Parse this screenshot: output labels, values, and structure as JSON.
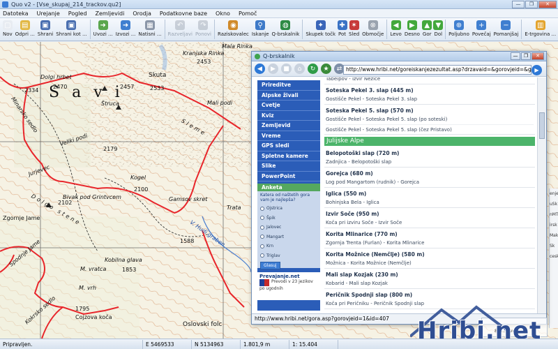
{
  "window": {
    "title": "Quo v2 - [Vse_skupaj_214_trackov.qu2]",
    "controls": [
      "—",
      "❐",
      "✕"
    ]
  },
  "menu": [
    "Datoteka",
    "Urejanje",
    "Pogled",
    "Zemljevidi",
    "Orodja",
    "Podatkovne baze",
    "Okno",
    "Pomoč"
  ],
  "toolbar": [
    {
      "label": "Nov",
      "icon": "new-document-icon",
      "color": "#e8ecf2",
      "glyph": "▢",
      "disabled": false
    },
    {
      "label": "Odpri ...",
      "icon": "open-folder-icon",
      "color": "#e2b844",
      "glyph": "▤",
      "disabled": false
    },
    {
      "label": "Shrani",
      "icon": "save-icon",
      "color": "#4a6fb0",
      "glyph": "▣",
      "disabled": false
    },
    {
      "label": "Shrani kot ...",
      "icon": "save-as-icon",
      "color": "#4a6fb0",
      "glyph": "▣",
      "disabled": false
    },
    {
      "label": "Uvozi ...",
      "icon": "import-icon",
      "color": "#5aa64d",
      "glyph": "➜",
      "disabled": false
    },
    {
      "label": "Izvozi ...",
      "icon": "export-icon",
      "color": "#3f7fd0",
      "glyph": "➜",
      "disabled": false
    },
    {
      "label": "Natisni ...",
      "icon": "print-icon",
      "color": "#8a96a8",
      "glyph": "▦",
      "disabled": false
    },
    {
      "label": "Razveljavi",
      "icon": "undo-icon",
      "color": "#9aa3af",
      "glyph": "↶",
      "disabled": true
    },
    {
      "label": "Ponovi",
      "icon": "redo-icon",
      "color": "#9aa3af",
      "glyph": "↷",
      "disabled": true
    },
    {
      "label": "Raziskovalec",
      "icon": "explorer-icon",
      "color": "#d08a2a",
      "glyph": "◉",
      "disabled": false
    },
    {
      "label": "Iskanje",
      "icon": "search-icon",
      "color": "#3e7ac8",
      "glyph": "⚲",
      "disabled": false
    },
    {
      "label": "Q-brskalnik",
      "icon": "q-browser-icon",
      "color": "#2d8a44",
      "glyph": "◍",
      "disabled": false
    },
    {
      "label": "Skupek točk",
      "icon": "waypoints-icon",
      "color": "#3a65b8",
      "glyph": "✦",
      "disabled": false
    },
    {
      "label": "Pot",
      "icon": "route-icon",
      "color": "#3a72c4",
      "glyph": "✚",
      "disabled": false
    },
    {
      "label": "Sled",
      "icon": "track-icon",
      "color": "#c73a3a",
      "glyph": "✶",
      "disabled": false
    },
    {
      "label": "Območje",
      "icon": "area-icon",
      "color": "#9aa3af",
      "glyph": "⊗",
      "disabled": false
    },
    {
      "label": "Levo",
      "icon": "arrow-left-icon",
      "color": "#43a83c",
      "glyph": "◀",
      "disabled": false
    },
    {
      "label": "Desno",
      "icon": "arrow-right-icon",
      "color": "#43a83c",
      "glyph": "▶",
      "disabled": false
    },
    {
      "label": "Gor",
      "icon": "arrow-up-icon",
      "color": "#43a83c",
      "glyph": "▲",
      "disabled": false
    },
    {
      "label": "Dol",
      "icon": "arrow-down-icon",
      "color": "#43a83c",
      "glyph": "▼",
      "disabled": false
    },
    {
      "label": "Poljubno",
      "icon": "zoom-custom-icon",
      "color": "#3f7fd0",
      "glyph": "⊕",
      "disabled": false
    },
    {
      "label": "Povečaj",
      "icon": "zoom-in-icon",
      "color": "#3f7fd0",
      "glyph": "+",
      "disabled": false
    },
    {
      "label": "Pomanjšaj",
      "icon": "zoom-out-icon",
      "color": "#3f7fd0",
      "glyph": "−",
      "disabled": false
    },
    {
      "label": "E-trgovina ...",
      "icon": "eshop-icon",
      "color": "#e3a42e",
      "glyph": "▥",
      "disabled": false
    }
  ],
  "map": {
    "region_label": "Savi",
    "peaks": [
      {
        "name": "Skuta",
        "elev": "2533"
      },
      {
        "name": "Kranjska Rinka",
        "elev": "2453"
      },
      {
        "name": "Mala Rinka",
        "elev": ""
      },
      {
        "name": "Dolgi hrbet",
        "elev": "2470"
      },
      {
        "name": "Štruca",
        "elev": "2457"
      },
      {
        "name": "Mali podi",
        "elev": ""
      },
      {
        "name": "Veliki podi",
        "elev": "2179"
      },
      {
        "name": "Kogel",
        "elev": "2100"
      },
      {
        "name": "Gamsov skret",
        "elev": ""
      },
      {
        "name": "Bivak pod Grintvcem",
        "elev": "2102"
      },
      {
        "name": "Kobilna glava",
        "elev": "1853"
      },
      {
        "name": "M. vratca",
        "elev": ""
      },
      {
        "name": "M. vrh",
        "elev": "1795"
      },
      {
        "name": "Cojzova koča",
        "elev": ""
      },
      {
        "name": "Oslovski folc",
        "elev": ""
      },
      {
        "name": "Trata",
        "elev": ""
      },
      {
        "name": "Zgornje Jame",
        "elev": ""
      },
      {
        "name": "Spodnje Jame",
        "elev": ""
      },
      {
        "name": "Kokrsko sedlo",
        "elev": ""
      },
      {
        "name": "Jurjevec",
        "elev": ""
      },
      {
        "name": "Dolgo stene",
        "elev": ""
      },
      {
        "name": "Minarsko sedlo",
        "elev": ""
      },
      {
        "name": "V. Hudi graben",
        "elev": "1588"
      },
      {
        "name": "Sleme",
        "elev": ""
      },
      {
        "name": "2334",
        "elev": ""
      }
    ]
  },
  "browser": {
    "title": "Q-brskalnik",
    "url": "http://www.hribi.net/goreiskanjezezultat.asp?drzavaid=&gorovjeid=&gorai",
    "status_url": "http://www.hribi.net/gora.asp?gorovjeid=1&id=407",
    "sidebar": [
      "Prireditve",
      "Alpske živali",
      "Cvetje",
      "Kviz",
      "Zemljevid",
      "Vreme",
      "GPS sledi",
      "Spletne kamere",
      "Slike",
      "PowerPoint"
    ],
    "poll": {
      "title": "Anketa",
      "question": "Katera od naštetih gora vam je najlepša?",
      "options": [
        "Ojstrica",
        "Špik",
        "Jalovec",
        "Mangart",
        "Krn",
        "Triglav"
      ],
      "vote_label": "Glasuj"
    },
    "promo": {
      "title": "Prevajanje.net",
      "text": "Prevodi v 23 jezikov po ugodnih"
    },
    "top_partial": "Tabelpov - Izvir Nežice",
    "entries_top": [
      {
        "name": "Soteska Pekel 3. slap (445 m)",
        "sub": [
          "Gostišče Pekel - Soteska Pekel 3. slap"
        ]
      },
      {
        "name": "Soteska Pekel 5. slap (570 m)",
        "sub": [
          "Gostišče Pekel - Soteska Pekel 5. slap (po soteski)",
          "Gostišče Pekel - Soteska Pekel 5. slap (čez Pristavo)"
        ]
      }
    ],
    "section": "Julijske Alpe",
    "entries": [
      {
        "name": "Belopotoški slap (720 m)",
        "sub": [
          "Zadnjica - Belopotoški slap"
        ]
      },
      {
        "name": "Gorejca (680 m)",
        "sub": [
          "Log pod Mangartom (rudnik) - Gorejca"
        ]
      },
      {
        "name": "Iglica (550 m)",
        "sub": [
          "Bohinjska Bela - Iglica"
        ]
      },
      {
        "name": "Izvir Soče (950 m)",
        "sub": [
          "Koča pri izviru Soče - Izvir Soče"
        ]
      },
      {
        "name": "Korita Mlinarice (770 m)",
        "sub": [
          "Zgornja Trenta (Furlan) - Korita Mlinarice"
        ]
      },
      {
        "name": "Korita Možnice (Nemčlje) (580 m)",
        "sub": [
          "Možnica - Korita Možnice (Nemčlje)"
        ]
      },
      {
        "name": "Mali slap Kozjak (230 m)",
        "sub": [
          "Kobarid - Mali slap Kozjak"
        ]
      },
      {
        "name": "Peričnik Spodnji slap (800 m)",
        "sub": [
          "Koča pri Peričniku - Peričnik Spodnji slap"
        ]
      }
    ]
  },
  "statusbar": {
    "ready": "Pripravljen.",
    "east": "E 5469533",
    "north": "N 5134963",
    "distance": "1.801,9 m",
    "scale": "1: 15.404"
  },
  "side_panel": [
    "enje",
    "uSk",
    "nMT",
    "irsk",
    "Mak",
    "Sk",
    "cesk"
  ],
  "legend_text": "8Mi...ovec",
  "watermark": "Hribi.net",
  "colors": {
    "track": "#e8262b",
    "sidebar_blue": "#2b5db8",
    "section_green": "#4cb46a",
    "map_bg": "#f6f2e4"
  }
}
